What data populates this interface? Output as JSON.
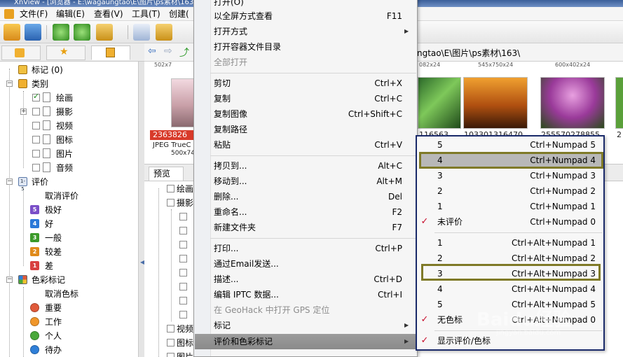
{
  "window": {
    "title": "XnView - [浏览器 - E:\\wagaungtao\\E\\图片\\ps素材\\163\\]"
  },
  "menubar": {
    "items": [
      "文件(F)",
      "编辑(E)",
      "查看(V)",
      "工具(T)",
      "创建("
    ]
  },
  "address": {
    "path": "ngtao\\E\\图片\\ps素材\\163\\"
  },
  "tree": {
    "tags": "标记 (0)",
    "categories": "类别",
    "category_items": [
      "绘画",
      "摄影",
      "视频",
      "图标",
      "图片",
      "音频"
    ],
    "rating": "评价",
    "rating_items": [
      "取消评价",
      "极好",
      "好",
      "一般",
      "较差",
      "差"
    ],
    "rating_badges": [
      "5",
      "4",
      "3",
      "2",
      "1"
    ],
    "colors": "色彩标记",
    "color_items": [
      "取消色标",
      "重要",
      "工作",
      "个人",
      "待办"
    ],
    "color_values": [
      "#e05a3a",
      "#f0962a",
      "#49a83a",
      "#2f7fd8"
    ]
  },
  "thumbnails": {
    "top_dims": [
      "502x7",
      "082x24",
      "545x750x24",
      "600x402x24"
    ],
    "selected_caption": "2363826",
    "selected_type": "JPEG TrueC",
    "selected_dims": "500x74",
    "captions": [
      "116563",
      "103301316470",
      "255570278855",
      "2"
    ]
  },
  "bottom": {
    "tab": "预览",
    "tree_items": [
      "绘画",
      "摄影",
      "视频",
      "图标",
      "图片"
    ]
  },
  "context_menu": {
    "items": [
      {
        "label": "打开(O)",
        "shortcut": ""
      },
      {
        "label": "以全屏方式查看",
        "shortcut": "F11"
      },
      {
        "label": "打开方式",
        "shortcut": ""
      },
      {
        "label": "打开容器文件目录",
        "shortcut": ""
      },
      {
        "label": "全部打开",
        "shortcut": ""
      },
      {
        "label": "剪切",
        "shortcut": "Ctrl+X"
      },
      {
        "label": "复制",
        "shortcut": "Ctrl+C"
      },
      {
        "label": "复制图像",
        "shortcut": "Ctrl+Shift+C"
      },
      {
        "label": "复制路径",
        "shortcut": ""
      },
      {
        "label": "粘贴",
        "shortcut": "Ctrl+V"
      },
      {
        "label": "拷贝到...",
        "shortcut": "Alt+C"
      },
      {
        "label": "移动到...",
        "shortcut": "Alt+M"
      },
      {
        "label": "删除...",
        "shortcut": "Del"
      },
      {
        "label": "重命名...",
        "shortcut": "F2"
      },
      {
        "label": "新建文件夹",
        "shortcut": "F7"
      },
      {
        "label": "打印...",
        "shortcut": "Ctrl+P"
      },
      {
        "label": "通过Email发送...",
        "shortcut": ""
      },
      {
        "label": "描述...",
        "shortcut": "Ctrl+D"
      },
      {
        "label": "编辑 IPTC 数据...",
        "shortcut": "Ctrl+I"
      },
      {
        "label": "在 GeoHack 中打开 GPS 定位",
        "shortcut": ""
      },
      {
        "label": "标记",
        "shortcut": ""
      },
      {
        "label": "评价和色彩标记",
        "shortcut": ""
      }
    ]
  },
  "submenu": {
    "items": [
      {
        "label": "5",
        "shortcut": "Ctrl+Numpad 5"
      },
      {
        "label": "4",
        "shortcut": "Ctrl+Numpad 4"
      },
      {
        "label": "3",
        "shortcut": "Ctrl+Numpad 3"
      },
      {
        "label": "2",
        "shortcut": "Ctrl+Numpad 2"
      },
      {
        "label": "1",
        "shortcut": "Ctrl+Numpad 1"
      },
      {
        "label": "未评价",
        "shortcut": "Ctrl+Numpad 0"
      },
      {
        "label": "1",
        "shortcut": "Ctrl+Alt+Numpad 1"
      },
      {
        "label": "2",
        "shortcut": "Ctrl+Alt+Numpad 2"
      },
      {
        "label": "3",
        "shortcut": "Ctrl+Alt+Numpad 3"
      },
      {
        "label": "4",
        "shortcut": "Ctrl+Alt+Numpad 4"
      },
      {
        "label": "5",
        "shortcut": "Ctrl+Alt+Numpad 5"
      },
      {
        "label": "无色标",
        "shortcut": "Ctrl+Alt+Numpad 0"
      },
      {
        "label": "显示评价/色标",
        "shortcut": ""
      }
    ]
  },
  "watermark": {
    "text": "Baidu经验",
    "sub": "jingyan.baidu.com"
  }
}
